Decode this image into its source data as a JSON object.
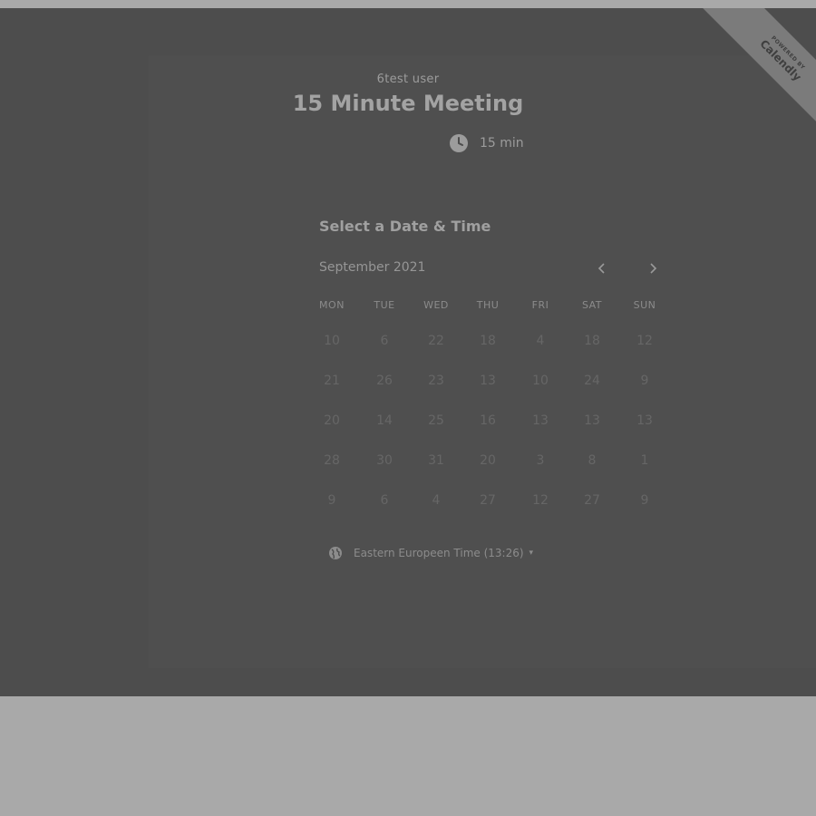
{
  "header": {
    "owner": "6test user",
    "title": "15 Minute Meeting",
    "duration": "15 min",
    "duration_icon": "clock-icon"
  },
  "ribbon": {
    "powered_by": "POWERED BY",
    "brand": "Calendly"
  },
  "calendar": {
    "heading": "Select a Date & Time",
    "month": "September 2021",
    "prev_icon": "chevron-left-icon",
    "next_icon": "chevron-right-icon",
    "weekdays": [
      "MON",
      "TUE",
      "WED",
      "THU",
      "FRI",
      "SAT",
      "SUN"
    ],
    "weeks": [
      [
        "10",
        "6",
        "22",
        "18",
        "4",
        "18",
        "12"
      ],
      [
        "21",
        "26",
        "23",
        "13",
        "10",
        "24",
        "9"
      ],
      [
        "20",
        "14",
        "25",
        "16",
        "13",
        "13",
        "13"
      ],
      [
        "28",
        "30",
        "31",
        "20",
        "3",
        "8",
        "1"
      ],
      [
        "9",
        "6",
        "4",
        "27",
        "12",
        "27",
        "9"
      ]
    ]
  },
  "timezone": {
    "icon": "globe-icon",
    "label": "Eastern Europeen Time (13:26)",
    "caret": "▾"
  },
  "colors": {
    "page_bg": "#a9a9a9",
    "overlay": "#4d4d4d",
    "ribbon": "#7b7b7b"
  }
}
